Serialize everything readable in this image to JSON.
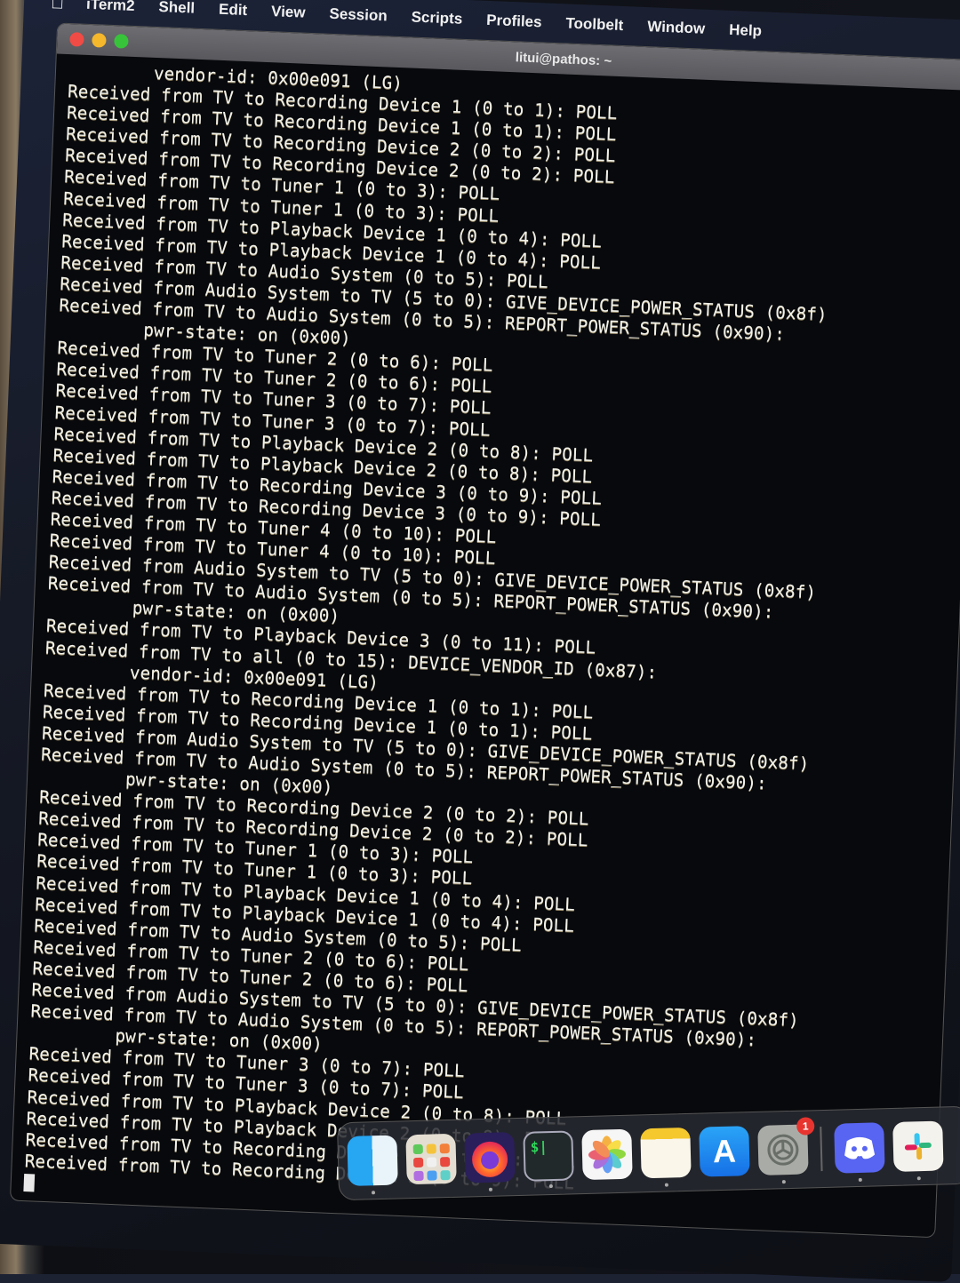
{
  "menubar": {
    "apple_icon": "apple-logo",
    "items": [
      "iTerm2",
      "Shell",
      "Edit",
      "View",
      "Session",
      "Scripts",
      "Profiles",
      "Toolbelt",
      "Window",
      "Help"
    ]
  },
  "window": {
    "title": "litui@pathos: ~",
    "buttons": [
      "close",
      "minimize",
      "zoom"
    ]
  },
  "terminal": {
    "lines": [
      {
        "indent": true,
        "text": "vendor-id: 0x00e091 (LG)"
      },
      {
        "indent": false,
        "text": "Received from TV to Recording Device 1 (0 to 1): POLL"
      },
      {
        "indent": false,
        "text": "Received from TV to Recording Device 1 (0 to 1): POLL"
      },
      {
        "indent": false,
        "text": "Received from TV to Recording Device 2 (0 to 2): POLL"
      },
      {
        "indent": false,
        "text": "Received from TV to Recording Device 2 (0 to 2): POLL"
      },
      {
        "indent": false,
        "text": "Received from TV to Tuner 1 (0 to 3): POLL"
      },
      {
        "indent": false,
        "text": "Received from TV to Tuner 1 (0 to 3): POLL"
      },
      {
        "indent": false,
        "text": "Received from TV to Playback Device 1 (0 to 4): POLL"
      },
      {
        "indent": false,
        "text": "Received from TV to Playback Device 1 (0 to 4): POLL"
      },
      {
        "indent": false,
        "text": "Received from TV to Audio System (0 to 5): POLL"
      },
      {
        "indent": false,
        "text": "Received from Audio System to TV (5 to 0): GIVE_DEVICE_POWER_STATUS (0x8f)"
      },
      {
        "indent": false,
        "text": "Received from TV to Audio System (0 to 5): REPORT_POWER_STATUS (0x90):"
      },
      {
        "indent": true,
        "text": "pwr-state: on (0x00)"
      },
      {
        "indent": false,
        "text": "Received from TV to Tuner 2 (0 to 6): POLL"
      },
      {
        "indent": false,
        "text": "Received from TV to Tuner 2 (0 to 6): POLL"
      },
      {
        "indent": false,
        "text": "Received from TV to Tuner 3 (0 to 7): POLL"
      },
      {
        "indent": false,
        "text": "Received from TV to Tuner 3 (0 to 7): POLL"
      },
      {
        "indent": false,
        "text": "Received from TV to Playback Device 2 (0 to 8): POLL"
      },
      {
        "indent": false,
        "text": "Received from TV to Playback Device 2 (0 to 8): POLL"
      },
      {
        "indent": false,
        "text": "Received from TV to Recording Device 3 (0 to 9): POLL"
      },
      {
        "indent": false,
        "text": "Received from TV to Recording Device 3 (0 to 9): POLL"
      },
      {
        "indent": false,
        "text": "Received from TV to Tuner 4 (0 to 10): POLL"
      },
      {
        "indent": false,
        "text": "Received from TV to Tuner 4 (0 to 10): POLL"
      },
      {
        "indent": false,
        "text": "Received from Audio System to TV (5 to 0): GIVE_DEVICE_POWER_STATUS (0x8f)"
      },
      {
        "indent": false,
        "text": "Received from TV to Audio System (0 to 5): REPORT_POWER_STATUS (0x90):"
      },
      {
        "indent": true,
        "text": "pwr-state: on (0x00)"
      },
      {
        "indent": false,
        "text": "Received from TV to Playback Device 3 (0 to 11): POLL"
      },
      {
        "indent": false,
        "text": "Received from TV to all (0 to 15): DEVICE_VENDOR_ID (0x87):"
      },
      {
        "indent": true,
        "text": "vendor-id: 0x00e091 (LG)"
      },
      {
        "indent": false,
        "text": "Received from TV to Recording Device 1 (0 to 1): POLL"
      },
      {
        "indent": false,
        "text": "Received from TV to Recording Device 1 (0 to 1): POLL"
      },
      {
        "indent": false,
        "text": "Received from Audio System to TV (5 to 0): GIVE_DEVICE_POWER_STATUS (0x8f)"
      },
      {
        "indent": false,
        "text": "Received from TV to Audio System (0 to 5): REPORT_POWER_STATUS (0x90):"
      },
      {
        "indent": true,
        "text": "pwr-state: on (0x00)"
      },
      {
        "indent": false,
        "text": "Received from TV to Recording Device 2 (0 to 2): POLL"
      },
      {
        "indent": false,
        "text": "Received from TV to Recording Device 2 (0 to 2): POLL"
      },
      {
        "indent": false,
        "text": "Received from TV to Tuner 1 (0 to 3): POLL"
      },
      {
        "indent": false,
        "text": "Received from TV to Tuner 1 (0 to 3): POLL"
      },
      {
        "indent": false,
        "text": "Received from TV to Playback Device 1 (0 to 4): POLL"
      },
      {
        "indent": false,
        "text": "Received from TV to Playback Device 1 (0 to 4): POLL"
      },
      {
        "indent": false,
        "text": "Received from TV to Audio System (0 to 5): POLL"
      },
      {
        "indent": false,
        "text": "Received from TV to Tuner 2 (0 to 6): POLL"
      },
      {
        "indent": false,
        "text": "Received from TV to Tuner 2 (0 to 6): POLL"
      },
      {
        "indent": false,
        "text": "Received from Audio System to TV (5 to 0): GIVE_DEVICE_POWER_STATUS (0x8f)"
      },
      {
        "indent": false,
        "text": "Received from TV to Audio System (0 to 5): REPORT_POWER_STATUS (0x90):"
      },
      {
        "indent": true,
        "text": "pwr-state: on (0x00)"
      },
      {
        "indent": false,
        "text": "Received from TV to Tuner 3 (0 to 7): POLL"
      },
      {
        "indent": false,
        "text": "Received from TV to Tuner 3 (0 to 7): POLL"
      },
      {
        "indent": false,
        "text": "Received from TV to Playback Device 2 (0 to 8): POLL"
      },
      {
        "indent": false,
        "text": "Received from TV to Playback Device 2 (0 to 8): POLL"
      },
      {
        "indent": false,
        "text": "Received from TV to Recording Device 3 (0 to 9): POLL"
      },
      {
        "indent": false,
        "text": "Received from TV to Recording Device 3 (0 to 9): POLL"
      }
    ],
    "cursor": "block-cursor"
  },
  "dock": {
    "apps": [
      {
        "name": "Finder",
        "icon": "finder-icon",
        "running": true
      },
      {
        "name": "Launchpad",
        "icon": "launchpad-icon",
        "running": false
      },
      {
        "name": "Firefox",
        "icon": "firefox-icon",
        "running": true
      },
      {
        "name": "Terminal",
        "icon": "terminal-icon",
        "running": true,
        "glyph": "$|"
      },
      {
        "name": "Photos",
        "icon": "photos-icon",
        "running": false
      },
      {
        "name": "Notes",
        "icon": "notes-icon",
        "running": true
      },
      {
        "name": "App Store",
        "icon": "app-store-icon",
        "running": false,
        "glyph": "A"
      },
      {
        "name": "System Settings",
        "icon": "system-settings-icon",
        "running": true,
        "badge": "1"
      }
    ],
    "recent_apps": [
      {
        "name": "Discord",
        "icon": "discord-icon",
        "running": true
      },
      {
        "name": "Slack",
        "icon": "slack-icon",
        "running": true
      }
    ]
  }
}
